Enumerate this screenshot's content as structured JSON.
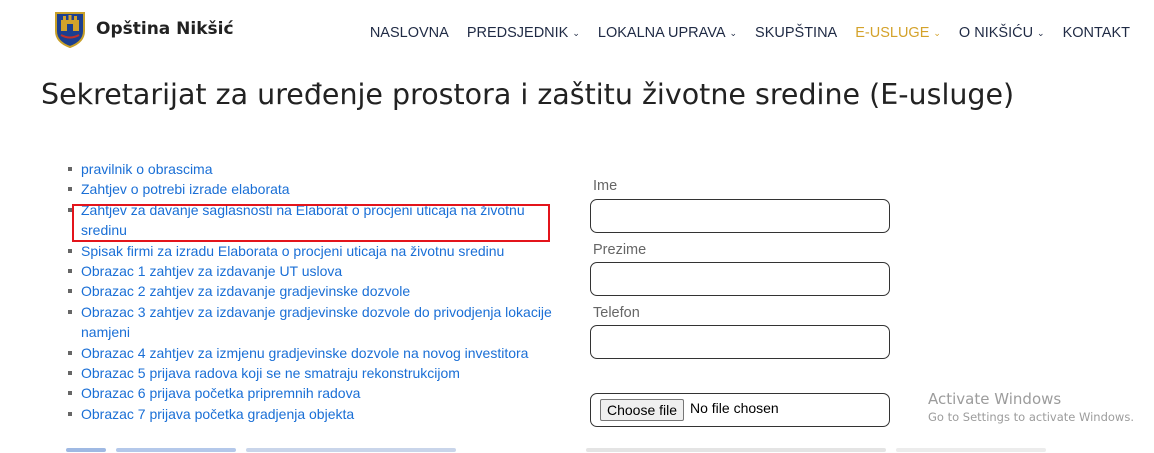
{
  "header": {
    "brand": "Opština Nikšić",
    "nav": [
      {
        "label": "NASLOVNA",
        "dropdown": false,
        "active": false
      },
      {
        "label": "PREDSJEDNIK",
        "dropdown": true,
        "active": false
      },
      {
        "label": "LOKALNA UPRAVA",
        "dropdown": true,
        "active": false
      },
      {
        "label": "SKUPŠTINA",
        "dropdown": false,
        "active": false
      },
      {
        "label": "E-USLUGE",
        "dropdown": true,
        "active": true
      },
      {
        "label": "O NIKŠIĆU",
        "dropdown": true,
        "active": false
      },
      {
        "label": "KONTAKT",
        "dropdown": false,
        "active": false
      }
    ],
    "chevron": "⌄"
  },
  "page": {
    "title": "Sekretarijat za uređenje prostora i zaštitu životne sredine (E-usluge)"
  },
  "links": [
    "pravilnik o obrascima",
    "Zahtjev o potrebi izrade elaborata",
    "Zahtjev za davanje saglasnosti na Elaborat o procjeni uticaja na životnu sredinu",
    "Spisak firmi za izradu Elaborata o procjeni uticaja na životnu sredinu",
    "Obrazac 1 zahtjev za izdavanje UT uslova",
    "Obrazac 2 zahtjev za izdavanje gradjevinske dozvole",
    "Obrazac 3 zahtjev za izdavanje gradjevinske dozvole do privodjenja lokacije namjeni",
    "Obrazac 4 zahtjev za izmjenu gradjevinske dozvole na novog investitora",
    "Obrazac 5 prijava radova koji se ne smatraju rekonstrukcijom",
    "Obrazac 6 prijava početka pripremnih radova",
    "Obrazac 7 prijava početka gradjenja objekta"
  ],
  "form": {
    "ime_label": "Ime",
    "ime_value": "",
    "prezime_label": "Prezime",
    "prezime_value": "",
    "telefon_label": "Telefon",
    "telefon_value": "",
    "file_button": "Choose file",
    "file_status": "No file chosen"
  },
  "watermark": {
    "title": "Activate Windows",
    "subtitle": "Go to Settings to activate Windows."
  },
  "colors": {
    "link": "#1a6fd6",
    "nav_active": "#d4a22a",
    "highlight": "#e3141b"
  },
  "icons": {
    "logo": "coat-of-arms-icon",
    "dropdown": "chevron-down-icon"
  }
}
